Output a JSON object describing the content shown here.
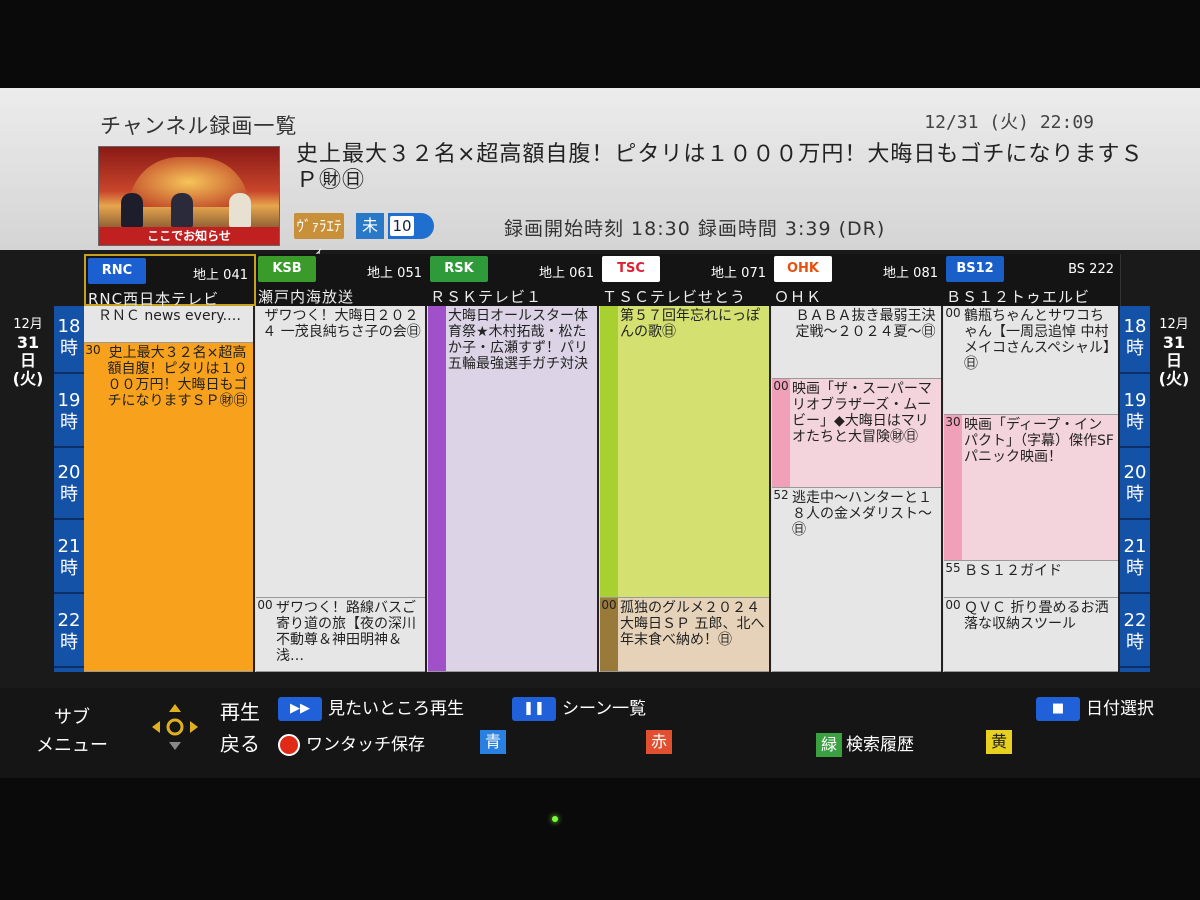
{
  "header": {
    "title": "チャンネル録画一覧",
    "datetime": "12/31 (火) 22:09",
    "thumbnail_caption": "ここでお知らせ",
    "program_title": "史上最大３２名×超高額自腹！ピタリは１０００万円！大晦日もゴチになりますＳＰ㊖㊐",
    "genre_icon": "ｳﾞｧﾗｴﾃｨ",
    "type_icon": "未",
    "channel_icon": "10",
    "rec_info": "録画開始時刻 18:30  録画時間  3:39 (DR)"
  },
  "channels": [
    {
      "logo": "RNC",
      "num": "地上 041",
      "name": "RNC西日本テレビ",
      "logo_color": "#1c5fd0"
    },
    {
      "logo": "KSB",
      "num": "地上 051",
      "name": "瀬戸内海放送",
      "logo_color": "#3a9a2a"
    },
    {
      "logo": "RSK",
      "num": "地上 061",
      "name": "ＲＳＫテレビ１",
      "logo_color": "#2f9a3a"
    },
    {
      "logo": "TSC",
      "num": "地上 071",
      "name": "ＴＳＣテレビせとう",
      "logo_color": "#e02030"
    },
    {
      "logo": "OHK",
      "num": "地上 081",
      "name": "ＯＨＫ",
      "logo_color": "#e85010"
    },
    {
      "logo": "BS12",
      "num": "BS 222",
      "name": "ＢＳ１２トゥエルビ",
      "logo_color": "#1a5ec8"
    }
  ],
  "date_label": {
    "month": "12月",
    "day": "31日",
    "weekday": "(火)"
  },
  "hours": [
    "18\n時",
    "19\n時",
    "20\n時",
    "21\n時",
    "22\n時"
  ],
  "programs": {
    "rnc": [
      {
        "min": "",
        "text": "ＲＮＣ news every.…"
      },
      {
        "min": "30",
        "text": "史上最大３２名×超高額自腹！ピタリは１０００万円！大晦日もゴチになりますＳＰ㊖㊐"
      }
    ],
    "ksb": [
      {
        "min": "",
        "text": "ザワつく！大晦日２０２４ 一茂良純ちさ子の会㊐"
      },
      {
        "min": "00",
        "text": "ザワつく！路線バスご寄り道の旅【夜の深川不動尊＆神田明神＆浅…"
      }
    ],
    "rsk": [
      {
        "min": "",
        "text": "大晦日オールスター体育祭★木村拓哉・松たか子・広瀬すず！パリ五輪最強選手ガチ対決"
      }
    ],
    "tsc": [
      {
        "min": "",
        "text": "第５７回年忘れにっぽんの歌㊐"
      },
      {
        "min": "00",
        "text": "孤独のグルメ２０２４大晦日ＳＰ 五郎、北へ 年末食べ納め！㊐"
      }
    ],
    "ohk": [
      {
        "min": "",
        "text": "ＢＡＢＡ抜き最弱王決定戦～２０２４夏～㊐"
      },
      {
        "min": "00",
        "text": "映画「ザ・スーパーマリオブラザーズ・ムービー」◆大晦日はマリオたちと大冒険㊖㊐"
      },
      {
        "min": "52",
        "text": "逃走中～ハンターと１８人の金メダリスト～㊐"
      }
    ],
    "bs12": [
      {
        "min": "00",
        "text": "鶴瓶ちゃんとサワコちゃん【一周忌追悼 中村メイコさんスペシャル】㊐"
      },
      {
        "min": "30",
        "text": "映画「ディープ・インパクト」（字幕）傑作SFパニック映画！"
      },
      {
        "min": "55",
        "text": "ＢＳ１２ガイド"
      },
      {
        "min": "00",
        "text": "ＱＶＣ 折り畳めるお洒落な収納スツール"
      }
    ]
  },
  "footer": {
    "submenu": "サブ\nメニュー",
    "play": "再生",
    "back": "戻る",
    "ff_label": "見たいところ再生",
    "pause_label": "シーン一覧",
    "record_label": "ワンタッチ保存",
    "blue": "青",
    "red": "赤",
    "green": "緑",
    "green_label": "検索履歴",
    "yellow": "黄",
    "stop_label": "日付選択"
  },
  "colors": {
    "rnc_fill": "#f7a11c",
    "ksb_fill": "#e6e6e6",
    "rsk_bar": "#a050c8",
    "rsk_fill": "#dcd4e6",
    "tsc_fill": "#d4e070",
    "tsc_bar": "#a8d030",
    "tsc_next": "#e6d2b8",
    "tsc_next_bar": "#9a7a3a",
    "ohk_movie": "#f4d4dc",
    "ohk_movie_bar": "#f0a0b8",
    "time_col": "#1452a8"
  }
}
